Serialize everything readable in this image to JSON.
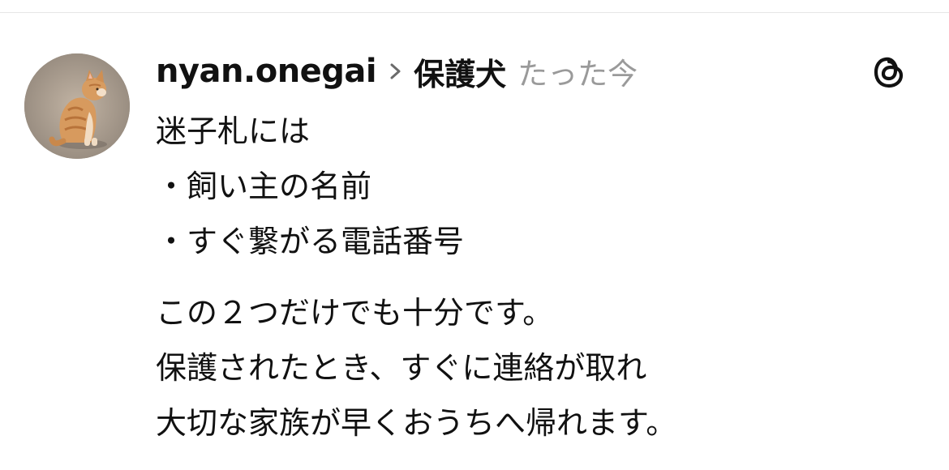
{
  "post": {
    "username": "nyan.onegai",
    "topic": "保護犬",
    "time": "たった今",
    "lines_a": [
      "迷子札には",
      "・飼い主の名前",
      "・すぐ繋がる電話番号"
    ],
    "lines_b": [
      "この２つだけでも十分です。",
      "保護されたとき、すぐに連絡が取れ",
      "大切な家族が早くおうちへ帰れます。"
    ]
  },
  "icons": {
    "avatar": "cat-photo",
    "separator": "chevron-right-icon",
    "app": "threads-logo-icon"
  }
}
